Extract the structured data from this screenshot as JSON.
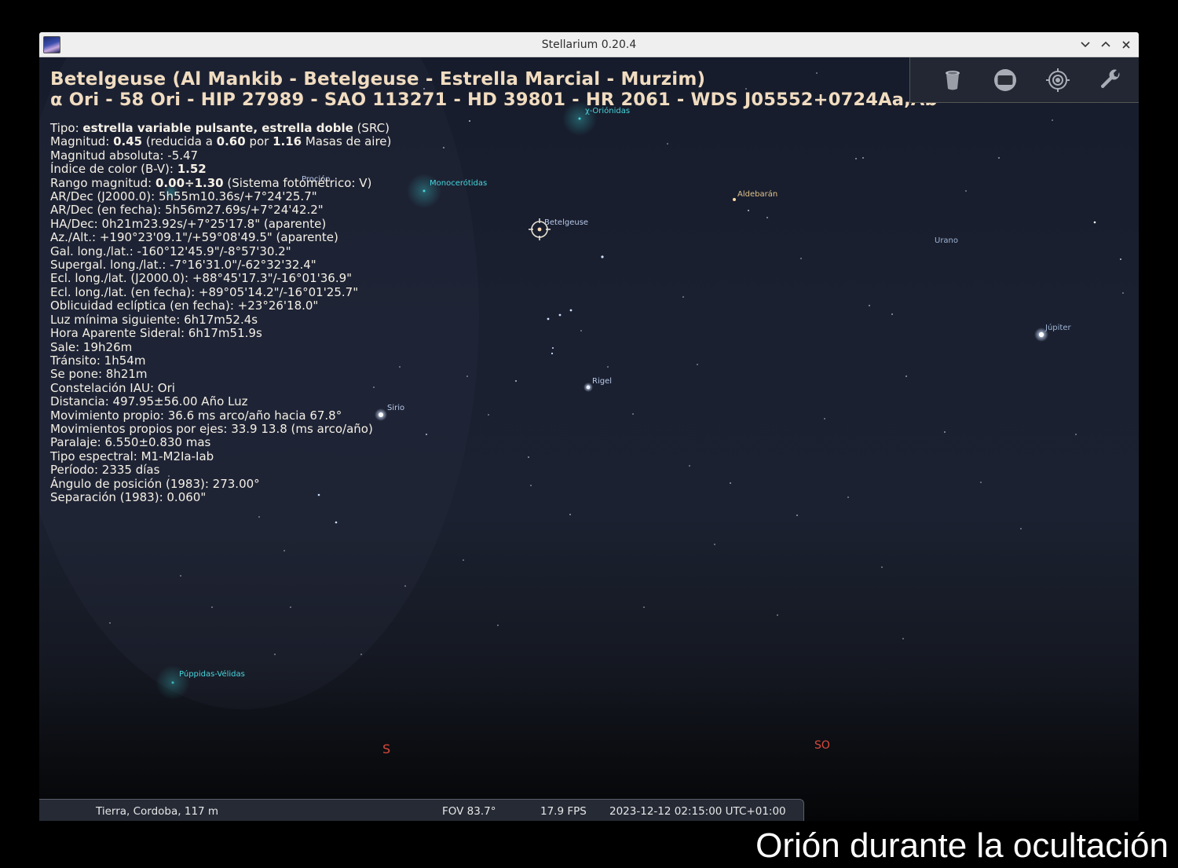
{
  "window": {
    "title": "Stellarium 0.20.4",
    "controls": [
      "chevron-down-icon",
      "chevron-up-icon",
      "close-icon"
    ]
  },
  "object": {
    "name_line": "Betelgeuse (Al Mankib - Betelgeuse - Estrella Marcial - Murzim)",
    "catalog_line": "α Ori - 58 Ori - HIP 27989 - SAO 113271 - HD 39801 - HR 2061 - WDS J05552+0724Aa,Ab"
  },
  "info": {
    "tipo_label": "Tipo: ",
    "tipo_value": "estrella variable pulsante, estrella doble",
    "tipo_suffix": " (SRC)",
    "mag_label": "Magnitud: ",
    "mag_value": "0.45",
    "mag_mid1": " (reducida a ",
    "mag_reduced": "0.60",
    "mag_mid2": " por ",
    "mag_airmass": "1.16",
    "mag_tail": " Masas de aire)",
    "abs_mag": "Magnitud absoluta: -5.47",
    "color_label": "Índice de color (B-V): ",
    "color_value": "1.52",
    "range_label": "Rango magnitud: ",
    "range_value": "0.00÷1.30",
    "range_tail": " (Sistema fotométrico: V)",
    "lines": [
      "AR/Dec (J2000.0): 5h55m10.36s/+7°24'25.7\"",
      "AR/Dec (en fecha): 5h56m27.69s/+7°24'42.2\"",
      "HA/Dec: 0h21m23.92s/+7°25'17.8\" (aparente)",
      "Az./Alt.: +190°23'09.1\"/+59°08'49.5\" (aparente)",
      "Gal. long./lat.: -160°12'45.9\"/-8°57'30.2\"",
      "Supergal. long./lat.: -7°16'31.0\"/-62°32'32.4\"",
      "Ecl. long./lat. (J2000.0): +88°45'17.3\"/-16°01'36.9\"",
      "Ecl. long./lat. (en fecha): +89°05'14.2\"/-16°01'25.7\"",
      "Oblicuidad eclíptica (en fecha): +23°26'18.0\"",
      "Luz mínima siguiente: 6h17m52.4s",
      "Hora Aparente Sideral: 6h17m51.9s",
      "Sale: 19h26m",
      "Tránsito: 1h54m",
      "Se pone: 8h21m",
      "Constelación IAU: Ori",
      "Distancia: 497.95±56.00 Año Luz",
      "Movimiento propio: 36.6 ms arco/año hacia 67.8°",
      "Movimientos propios por ejes: 33.9 13.8 (ms arco/año)",
      "Paralaje: 6.550±0.830 mas",
      "Tipo espectral: M1-M2Ia-Iab",
      "Período: 2335 días",
      "Ángulo de posición (1983): 273.00°",
      "Separación (1983): 0.060\""
    ]
  },
  "sky_labels": {
    "chi_orionidas": "χ-Oriónidas",
    "monocerotidas": "Monocerótidas",
    "procion": "Proción",
    "betelgeuse": "Betelgeuse",
    "aldebaran": "Aldebarán",
    "urano": "Urano",
    "jupiter": "Júpiter",
    "rigel": "Rigel",
    "sirio": "Sirio",
    "puppidas": "Púppidas-Vélidas",
    "south": "S",
    "southwest": "SO"
  },
  "toolbar": {
    "icons": [
      "trash-bin-icon",
      "screen-icon",
      "target-icon",
      "wrench-icon"
    ]
  },
  "status": {
    "location": "Tierra, Cordoba, 117 m",
    "fov": "FOV 83.7°",
    "fps": "17.9 FPS",
    "datetime": "2023-12-12 02:15:00 UTC+01:00"
  },
  "caption": "Orión durante la ocultación",
  "colors": {
    "header_text": "#f1dcc0",
    "meteor_label": "#47d6de",
    "cardinal": "#d94a3c"
  }
}
